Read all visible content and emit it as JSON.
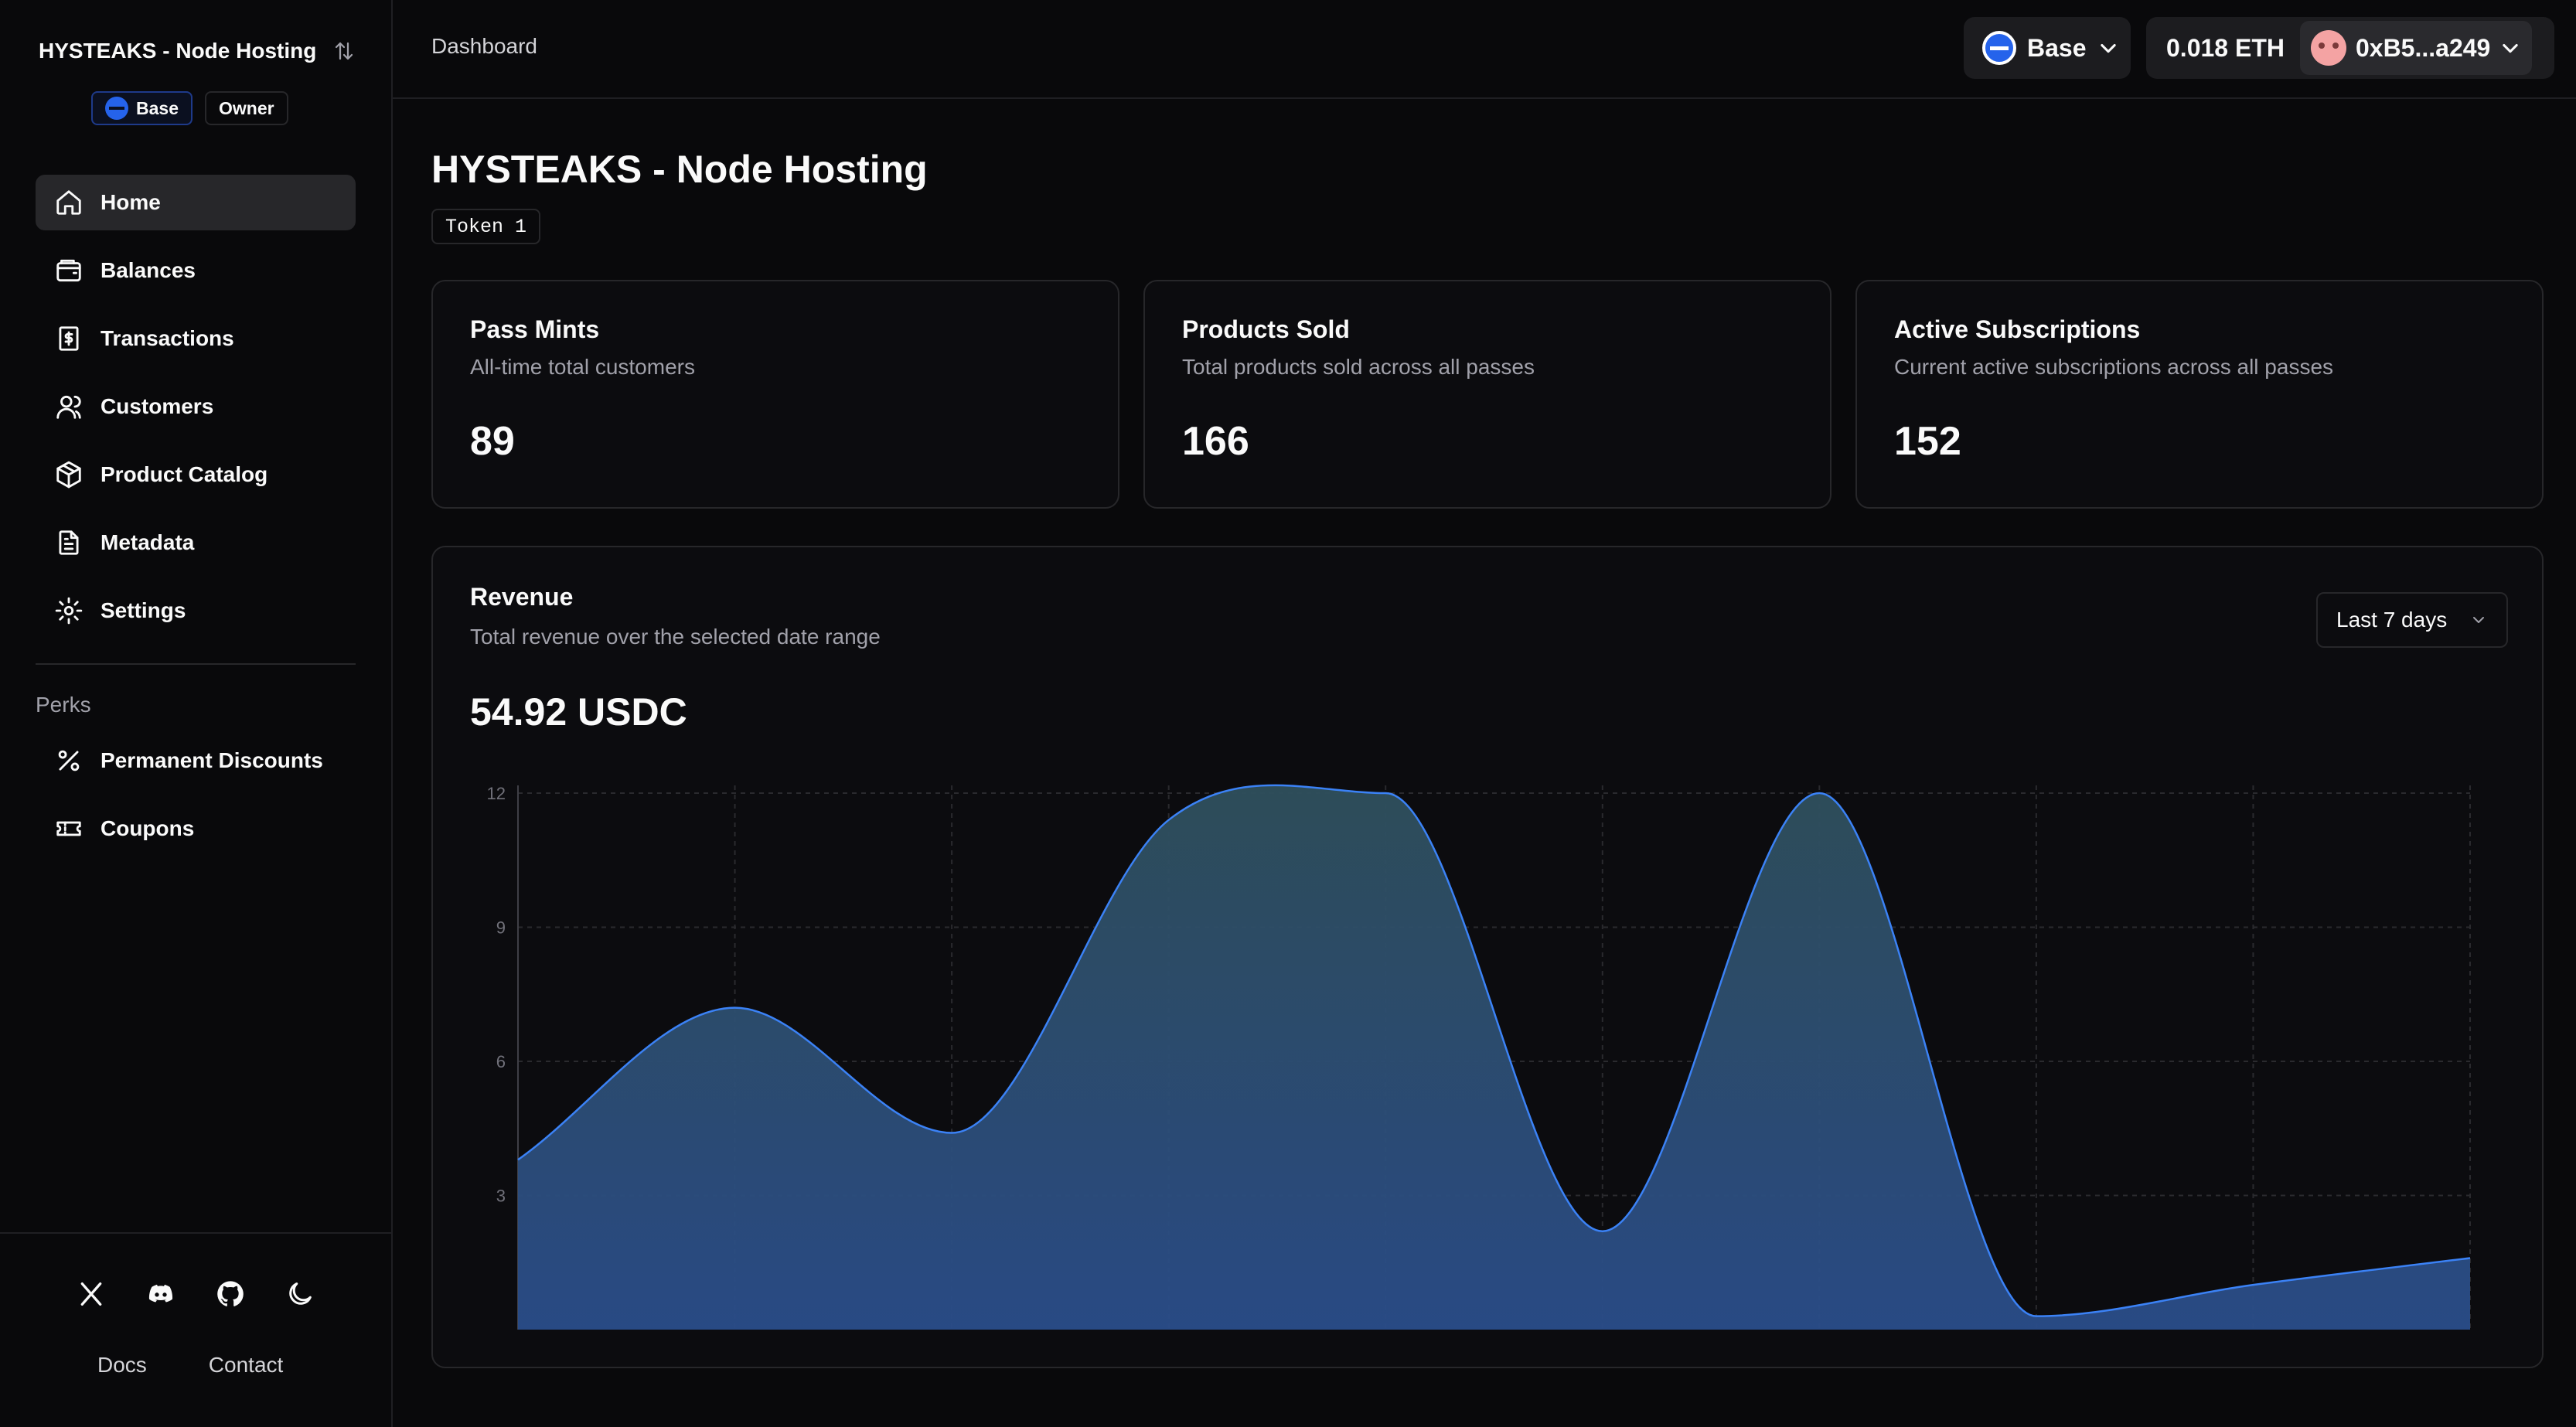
{
  "sidebar": {
    "brand": "HYSTEAKS - Node Hosting",
    "badges": {
      "chain": "Base",
      "role": "Owner"
    },
    "nav": [
      {
        "label": "Home",
        "icon": "home-icon",
        "active": true
      },
      {
        "label": "Balances",
        "icon": "wallet-icon"
      },
      {
        "label": "Transactions",
        "icon": "dollar-receipt-icon"
      },
      {
        "label": "Customers",
        "icon": "user-icon"
      },
      {
        "label": "Product Catalog",
        "icon": "package-icon"
      },
      {
        "label": "Metadata",
        "icon": "file-text-icon"
      },
      {
        "label": "Settings",
        "icon": "gear-icon"
      }
    ],
    "perks_label": "Perks",
    "perks": [
      {
        "label": "Permanent Discounts",
        "icon": "percent-icon"
      },
      {
        "label": "Coupons",
        "icon": "ticket-icon"
      }
    ],
    "footer": {
      "social_icons": [
        "x-icon",
        "discord-icon",
        "github-icon",
        "moon-icon"
      ],
      "links": [
        "Docs",
        "Contact"
      ]
    }
  },
  "topbar": {
    "breadcrumb": "Dashboard",
    "chain": "Base",
    "eth_balance": "0.018 ETH",
    "address": "0xB5...a249"
  },
  "main": {
    "title": "HYSTEAKS - Node Hosting",
    "token_tag": "Token 1",
    "stats": [
      {
        "title": "Pass Mints",
        "desc": "All-time total customers",
        "value": "89"
      },
      {
        "title": "Products Sold",
        "desc": "Total products sold across all passes",
        "value": "166"
      },
      {
        "title": "Active Subscriptions",
        "desc": "Current active subscriptions across all passes",
        "value": "152"
      }
    ],
    "revenue": {
      "title": "Revenue",
      "desc": "Total revenue over the selected date range",
      "total": "54.92 USDC",
      "range": "Last 7 days"
    }
  },
  "colors": {
    "background": "#09090b",
    "card": "#0c0c0f",
    "border": "#27272a",
    "accent": "#2563eb",
    "chart_line": "#3b82f6",
    "chart_fill_top": "#2f4f5c",
    "chart_fill_bottom": "#2a4d8a"
  },
  "chart_data": {
    "type": "area",
    "x": [
      0,
      1,
      2,
      3,
      4,
      5,
      6,
      7,
      8,
      9
    ],
    "values": [
      3.8,
      7.2,
      4.4,
      11.4,
      12.0,
      2.2,
      12.0,
      0.3,
      1.0,
      1.6
    ],
    "ylim": [
      0,
      12
    ],
    "yticks": [
      3,
      6,
      9,
      12
    ],
    "grid": true,
    "legend": "none",
    "title": "",
    "xlabel": "",
    "ylabel": ""
  }
}
